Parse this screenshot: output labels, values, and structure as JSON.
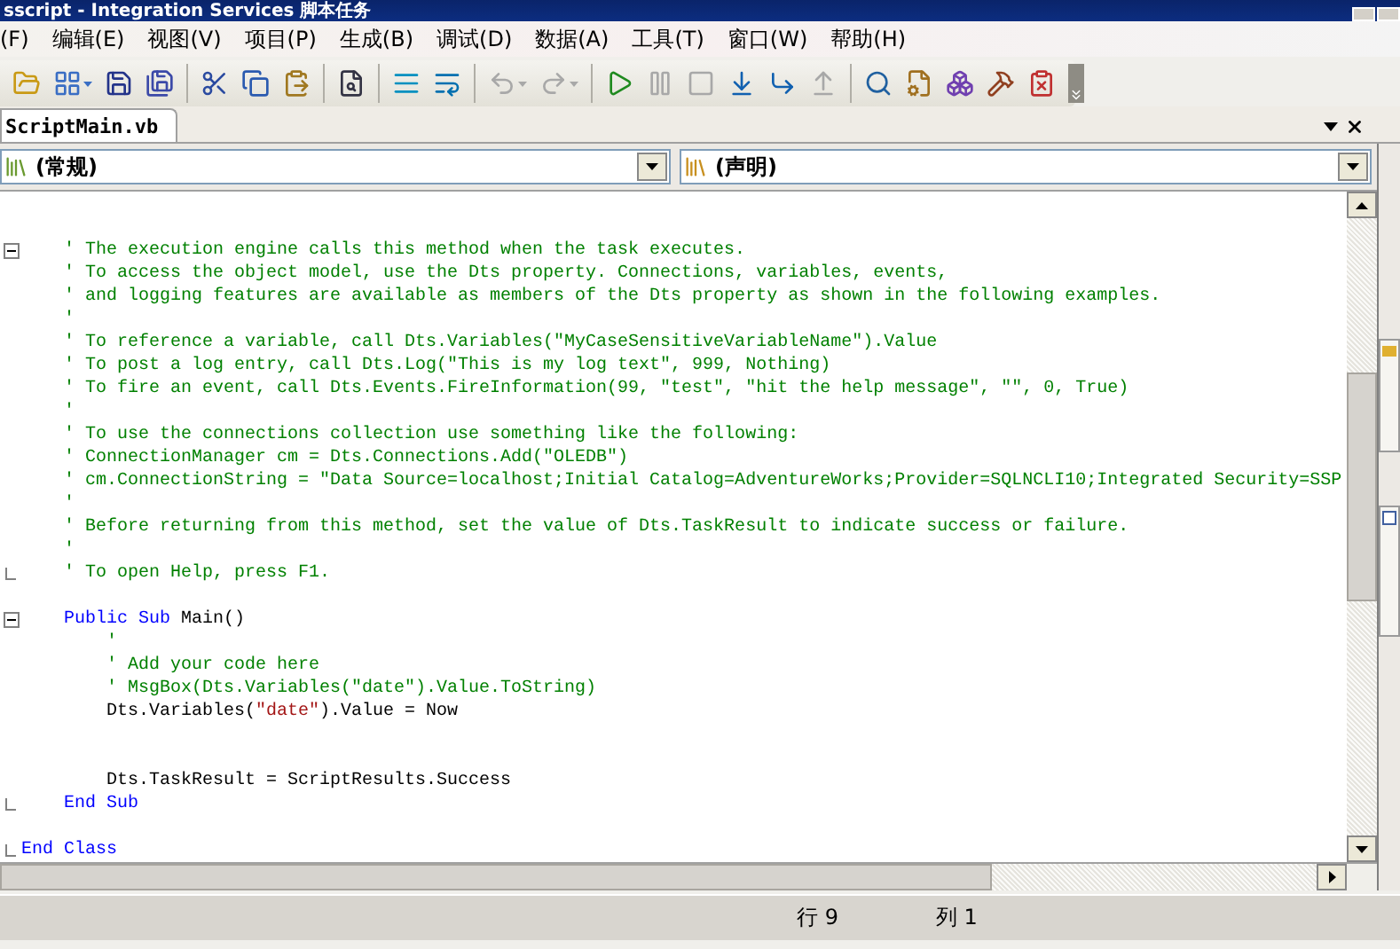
{
  "window": {
    "title": "sscript - Integration Services 脚本任务"
  },
  "menu": [
    {
      "label": "(F)"
    },
    {
      "label": "编辑(E)"
    },
    {
      "label": "视图(V)"
    },
    {
      "label": "项目(P)"
    },
    {
      "label": "生成(B)"
    },
    {
      "label": "调试(D)"
    },
    {
      "label": "数据(A)"
    },
    {
      "label": "工具(T)"
    },
    {
      "label": "窗口(W)"
    },
    {
      "label": "帮助(H)"
    }
  ],
  "toolbar": [
    [
      {
        "disabled": false
      },
      {
        "disabled": false
      },
      {
        "disabled": false
      },
      {
        "disabled": false
      }
    ],
    [
      {
        "disabled": false
      },
      {
        "disabled": false
      },
      {
        "disabled": false
      }
    ],
    [
      {
        "disabled": false
      }
    ],
    [
      {
        "disabled": false
      },
      {
        "disabled": false
      }
    ],
    [
      {
        "disabled": true
      },
      {
        "disabled": true
      }
    ],
    [
      {
        "disabled": false
      },
      {
        "disabled": true
      },
      {
        "disabled": true
      },
      {
        "disabled": false
      },
      {
        "disabled": false
      },
      {
        "disabled": true
      }
    ],
    [
      {
        "disabled": false
      },
      {
        "disabled": false
      },
      {
        "disabled": false
      },
      {
        "disabled": false
      },
      {
        "disabled": false
      }
    ]
  ],
  "tabs": [
    {
      "label": "ScriptMain.vb",
      "selected": true
    }
  ],
  "selectors": {
    "object": "(常规)",
    "member": "(声明)"
  },
  "code": {
    "lines": [
      {
        "kind": "blank"
      },
      {
        "kind": "blank"
      },
      {
        "kind": "block",
        "children": [
          {
            "kind": "code",
            "fold_start": true,
            "segments": [
              {
                "kind": "comment",
                "text": "' The execution engine calls this method when the task executes."
              }
            ]
          },
          {
            "kind": "code",
            "segments": [
              {
                "kind": "comment",
                "text": "' To access the object model, use the Dts property. Connections, variables, events,"
              }
            ]
          },
          {
            "kind": "code",
            "segments": [
              {
                "kind": "comment",
                "text": "' and logging features are available as members of the Dts property as shown in the following examples."
              }
            ]
          },
          {
            "kind": "code",
            "segments": [
              {
                "kind": "comment",
                "text": "'"
              }
            ]
          },
          {
            "kind": "code",
            "segments": [
              {
                "kind": "comment",
                "text": "' To reference a variable, call Dts.Variables(\"MyCaseSensitiveVariableName\").Value"
              }
            ]
          },
          {
            "kind": "code",
            "segments": [
              {
                "kind": "comment",
                "text": "' To post a log entry, call Dts.Log(\"This is my log text\", 999, Nothing)"
              }
            ]
          },
          {
            "kind": "code",
            "segments": [
              {
                "kind": "comment",
                "text": "' To fire an event, call Dts.Events.FireInformation(99, \"test\", \"hit the help message\", \"\", 0, True)"
              }
            ]
          },
          {
            "kind": "code",
            "segments": [
              {
                "kind": "comment",
                "text": "'"
              }
            ]
          },
          {
            "kind": "code",
            "segments": [
              {
                "kind": "comment",
                "text": "' To use the connections collection use something like the following:"
              }
            ]
          },
          {
            "kind": "code",
            "segments": [
              {
                "kind": "comment",
                "text": "' ConnectionManager cm = Dts.Connections.Add(\"OLEDB\")"
              }
            ]
          },
          {
            "kind": "code",
            "segments": [
              {
                "kind": "comment",
                "text": "' cm.ConnectionString = \"Data Source=localhost;Initial Catalog=AdventureWorks;Provider=SQLNCLI10;Integrated Security=SSP"
              }
            ]
          },
          {
            "kind": "code",
            "segments": [
              {
                "kind": "comment",
                "text": "'"
              }
            ]
          },
          {
            "kind": "code",
            "segments": [
              {
                "kind": "comment",
                "text": "' Before returning from this method, set the value of Dts.TaskResult to indicate success or failure."
              }
            ]
          },
          {
            "kind": "code",
            "segments": [
              {
                "kind": "comment",
                "text": "'"
              }
            ]
          },
          {
            "kind": "code",
            "fold_end": true,
            "segments": [
              {
                "kind": "comment",
                "text": "' To open Help, press F1."
              }
            ]
          },
          {
            "kind": "blank"
          },
          {
            "kind": "code",
            "fold_start": true,
            "segments": [
              {
                "kind": "keyword",
                "text": "Public Sub"
              },
              {
                "kind": "plain",
                "text": " Main()"
              }
            ],
            "children": [
              {
                "kind": "code",
                "segments": [
                  {
                    "kind": "comment",
                    "text": "'"
                  }
                ]
              },
              {
                "kind": "code",
                "segments": [
                  {
                    "kind": "comment",
                    "text": "' Add your code here"
                  }
                ]
              },
              {
                "kind": "code",
                "segments": [
                  {
                    "kind": "comment",
                    "text": "' MsgBox(Dts.Variables(\"date\").Value.ToString)"
                  }
                ]
              },
              {
                "kind": "code",
                "segments": [
                  {
                    "kind": "plain",
                    "text": "Dts.Variables("
                  },
                  {
                    "kind": "string",
                    "text": "\"date\""
                  },
                  {
                    "kind": "plain",
                    "text": ").Value = Now"
                  }
                ]
              },
              {
                "kind": "blank"
              },
              {
                "kind": "blank"
              },
              {
                "kind": "code",
                "segments": [
                  {
                    "kind": "plain",
                    "text": "Dts.TaskResult = ScriptResults.Success"
                  }
                ]
              }
            ]
          },
          {
            "kind": "code",
            "fold_end": true,
            "segments": [
              {
                "kind": "keyword",
                "text": "End Sub"
              }
            ]
          },
          {
            "kind": "blank"
          }
        ]
      },
      {
        "kind": "code",
        "fold_end": true,
        "segments": [
          {
            "kind": "keyword",
            "text": "End Class"
          }
        ]
      }
    ]
  },
  "status_bar": {
    "line": "行 9",
    "column": "列 1"
  }
}
